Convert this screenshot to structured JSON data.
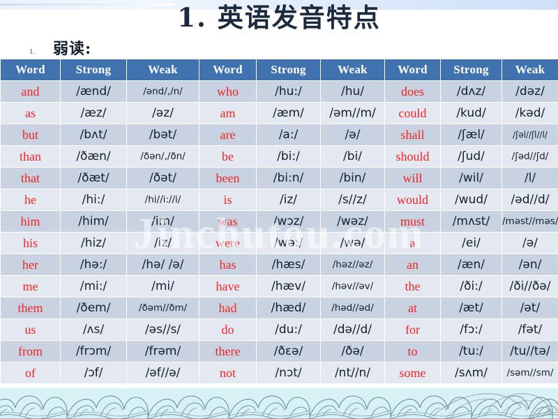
{
  "slide": {
    "title": "1. 英语发音特点",
    "subtitle_number": "1.",
    "subtitle_text": "弱读:",
    "watermark": "Jinchutou.com",
    "accent_header_color": "#3f72ae",
    "word_text_color": "#ef2424",
    "row_odd_color": "#c8d2e0",
    "row_even_color": "#e3e8f1",
    "wave_band_color": "#d6f2f5"
  },
  "table": {
    "headers": [
      "Word",
      "Strong",
      "Weak",
      "Word",
      "Strong",
      "Weak",
      "Word",
      "Strong",
      "Weak"
    ],
    "rows": [
      [
        "and",
        "/ænd/",
        "/ənd/,/n/",
        "who",
        "/hu:/",
        "/hu/",
        "does",
        "/dʌz/",
        "/dəz/"
      ],
      [
        "as",
        "/æz/",
        "/əz/",
        "am",
        "/æm/",
        "/əm//m/",
        "could",
        "/kud/",
        "/kəd/"
      ],
      [
        "but",
        "/bʌt/",
        "/bət/",
        "are",
        "/a:/",
        "/ə/",
        "shall",
        "/ʃæl/",
        "/ʃəl//ʃl//l/"
      ],
      [
        "than",
        "/ðæn/",
        "/ðən/,/ðn/",
        "be",
        "/bi:/",
        "/bi/",
        "should",
        "/ʃud/",
        "/ʃəd//ʃd/"
      ],
      [
        "that",
        "/ðæt/",
        "/ðət/",
        "been",
        "/bi:n/",
        "/bin/",
        "will",
        "/wil/",
        "/l/"
      ],
      [
        "he",
        "/hi:/",
        "/hi//i://i/",
        "is",
        "/iz/",
        "/s//z/",
        "would",
        "/wud/",
        "/əd//d/"
      ],
      [
        "him",
        "/him/",
        "/im/",
        "was",
        "/wɔz/",
        "/wəz/",
        "must",
        "/mʌst/",
        "/məst//məs/"
      ],
      [
        "his",
        "/hiz/",
        "/iz/",
        "were",
        "/wə:/",
        "/wə/",
        "a",
        "/ei/",
        "/ə/"
      ],
      [
        "her",
        "/hə:/",
        "/hə/ /ə/",
        "has",
        "/hæs/",
        "/həz//əz/",
        "an",
        "/æn/",
        "/ən/"
      ],
      [
        "me",
        "/mi:/",
        "/mi/",
        "have",
        "/hæv/",
        "/həv//əv/",
        "the",
        "/ði:/",
        "/ði//ðə/"
      ],
      [
        "them",
        "/ðem/",
        "/ðəm//ðm/",
        "had",
        "/hæd/",
        "/həd//əd/",
        "at",
        "/æt/",
        "/ət/"
      ],
      [
        "us",
        "/ʌs/",
        "/əs//s/",
        "do",
        "/du:/",
        "/də//d/",
        "for",
        "/fɔ:/",
        "/fət/"
      ],
      [
        "from",
        "/frɔm/",
        "/frəm/",
        "there",
        "/ðɛə/",
        "/ðə/",
        "to",
        "/tu:/",
        "/tu//tə/"
      ],
      [
        "of",
        "/ɔf/",
        "/əf//ə/",
        "not",
        "/nɔt/",
        "/nt//n/",
        "some",
        "/sʌm/",
        "/səm//sm/"
      ]
    ]
  }
}
